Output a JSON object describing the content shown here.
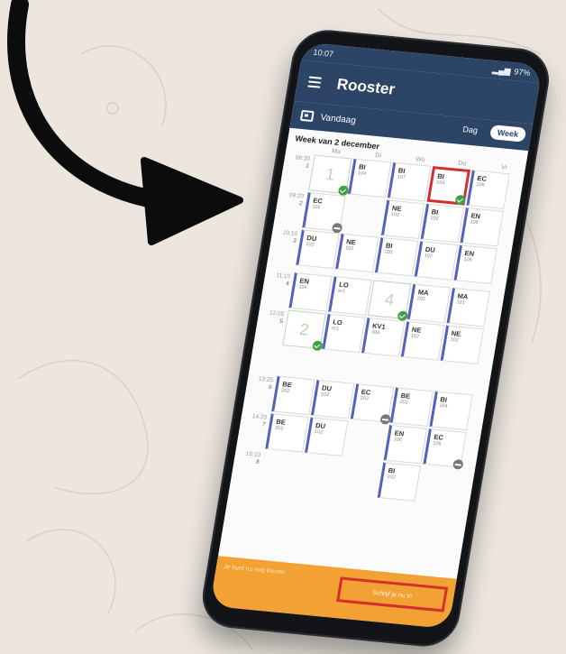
{
  "status_bar": {
    "time": "10:07",
    "right": "97%"
  },
  "app": {
    "title": "Rooster",
    "subtitle": "Vandaag"
  },
  "view_toggle": {
    "day": "Dag",
    "week": "Week"
  },
  "week": {
    "title": "Week van 2 december",
    "days": [
      "Ma",
      "Di",
      "Wo",
      "Do",
      "Vr"
    ]
  },
  "slots": [
    {
      "hour": "1",
      "time": "08:30"
    },
    {
      "hour": "2",
      "time": "09:20"
    },
    {
      "hour": "3",
      "time": "10:10"
    },
    {
      "hour": "4",
      "time": "11:15"
    },
    {
      "hour": "5",
      "time": "12:05"
    },
    {
      "hour": "6",
      "time": "13:25"
    },
    {
      "hour": "7",
      "time": "14:20"
    },
    {
      "hour": "8",
      "time": "15:10"
    }
  ],
  "lessons": {
    "a": {
      "code": "BI",
      "room": "104"
    },
    "b": {
      "code": "BI",
      "room": "107"
    },
    "c": {
      "code": "BI",
      "room": "104"
    },
    "d": {
      "code": "EC",
      "room": "106"
    },
    "e": {
      "code": "EC",
      "room": "106"
    },
    "f": {
      "code": "NE",
      "room": "102"
    },
    "g": {
      "code": "BI",
      "room": "202"
    },
    "h": {
      "code": "EN",
      "room": "106"
    },
    "i": {
      "code": "DU",
      "room": "102"
    },
    "j": {
      "code": "NE",
      "room": "102"
    },
    "k": {
      "code": "BI",
      "room": "201"
    },
    "l": {
      "code": "DU",
      "room": "102"
    },
    "m": {
      "code": "EN",
      "room": "106"
    },
    "n": {
      "code": "EN",
      "room": "106"
    },
    "o": {
      "code": "LO",
      "room": "er1"
    },
    "p": {
      "code": "MA",
      "room": "202"
    },
    "q": {
      "code": "MA",
      "room": "101"
    },
    "r": {
      "code": "LO",
      "room": "er1"
    },
    "s": {
      "code": "KV1",
      "room": "306"
    },
    "t": {
      "code": "NE",
      "room": "102"
    },
    "u": {
      "code": "NE",
      "room": "102"
    },
    "v": {
      "code": "BE",
      "room": "202"
    },
    "w": {
      "code": "DU",
      "room": "102"
    },
    "x": {
      "code": "EC",
      "room": "202"
    },
    "y": {
      "code": "BE",
      "room": "202"
    },
    "z": {
      "code": "BI",
      "room": "104"
    },
    "aa": {
      "code": "BE",
      "room": "202"
    },
    "ab": {
      "code": "DU",
      "room": "102"
    },
    "ac": {
      "code": "EN",
      "room": "106"
    },
    "ad": {
      "code": "EC",
      "room": "106"
    },
    "ae": {
      "code": "BI",
      "room": "202"
    }
  },
  "free_hours": {
    "mon1": "1",
    "mon5": "2",
    "wed5": "4"
  },
  "banner": {
    "message": "Je kunt nu nog kiezen",
    "link": "Schrijf je nu in"
  },
  "colors": {
    "header": "#2c4466",
    "accent": "#5661b9",
    "banner": "#f2a132",
    "highlight": "#d32f2f",
    "ok": "#43a047"
  }
}
